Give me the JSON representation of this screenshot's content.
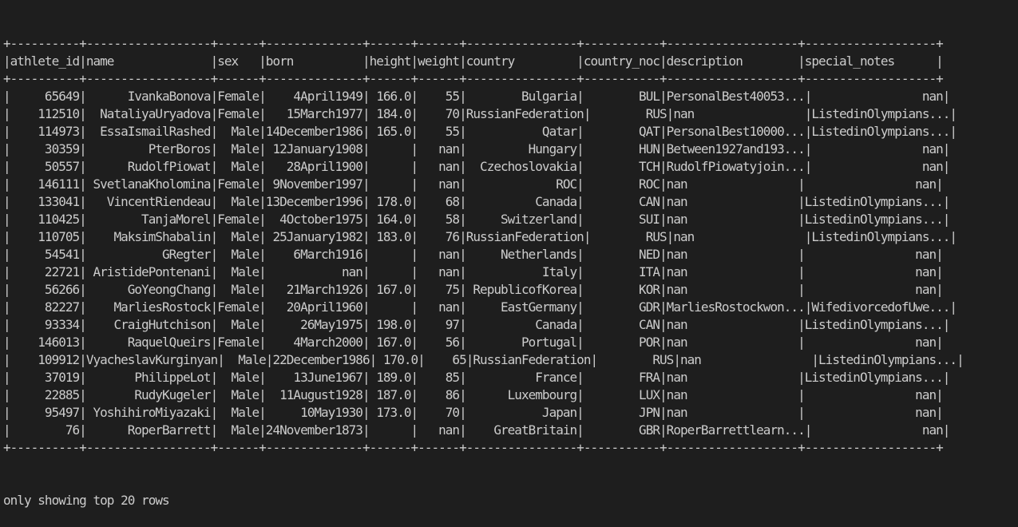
{
  "terminal": {
    "columns": [
      "athlete_id",
      "name",
      "sex",
      "born",
      "height",
      "weight",
      "country",
      "country_noc",
      "description",
      "special_notes"
    ],
    "column_widths": [
      10,
      18,
      6,
      14,
      6,
      6,
      16,
      11,
      19,
      19
    ],
    "align": [
      "right",
      "right",
      "right",
      "right",
      "right",
      "right",
      "right",
      "right",
      "left",
      "right"
    ],
    "rows": [
      [
        "65649",
        "IvankaBonova",
        "Female",
        "4April1949",
        "166.0",
        "55",
        "Bulgaria",
        "BUL",
        "PersonalBest40053...",
        "nan"
      ],
      [
        "112510",
        "NataliyaUryadova",
        "Female",
        "15March1977",
        "184.0",
        "70",
        "RussianFederation",
        "RUS",
        "nan",
        "ListedinOlympians..."
      ],
      [
        "114973",
        "EssaIsmailRashed",
        "Male",
        "14December1986",
        "165.0",
        "55",
        "Qatar",
        "QAT",
        "PersonalBest10000...",
        "ListedinOlympians..."
      ],
      [
        "30359",
        "PterBoros",
        "Male",
        "12January1908",
        "",
        "nan",
        "Hungary",
        "HUN",
        "Between1927and193...",
        "nan"
      ],
      [
        "50557",
        "RudolfPiowat",
        "Male",
        "28April1900",
        "",
        "nan",
        "Czechoslovakia",
        "TCH",
        "RudolfPiowatyjoin...",
        "nan"
      ],
      [
        "146111",
        "SvetlanaKholomina",
        "Female",
        "9November1997",
        "",
        "nan",
        "ROC",
        "ROC",
        "nan",
        "nan"
      ],
      [
        "133041",
        "VincentRiendeau",
        "Male",
        "13December1996",
        "178.0",
        "68",
        "Canada",
        "CAN",
        "nan",
        "ListedinOlympians..."
      ],
      [
        "110425",
        "TanjaMorel",
        "Female",
        "4October1975",
        "164.0",
        "58",
        "Switzerland",
        "SUI",
        "nan",
        "ListedinOlympians..."
      ],
      [
        "110705",
        "MaksimShabalin",
        "Male",
        "25January1982",
        "183.0",
        "76",
        "RussianFederation",
        "RUS",
        "nan",
        "ListedinOlympians..."
      ],
      [
        "54541",
        "GRegter",
        "Male",
        "6March1916",
        "",
        "nan",
        "Netherlands",
        "NED",
        "nan",
        "nan"
      ],
      [
        "22721",
        "AristidePontenani",
        "Male",
        "nan",
        "",
        "nan",
        "Italy",
        "ITA",
        "nan",
        "nan"
      ],
      [
        "56266",
        "GoYeongChang",
        "Male",
        "21March1926",
        "167.0",
        "75",
        "RepublicofKorea",
        "KOR",
        "nan",
        "nan"
      ],
      [
        "82227",
        "MarliesRostock",
        "Female",
        "20April1960",
        "",
        "nan",
        "EastGermany",
        "GDR",
        "MarliesRostockwon...",
        "WifedivorcedofUwe..."
      ],
      [
        "93334",
        "CraigHutchison",
        "Male",
        "26May1975",
        "198.0",
        "97",
        "Canada",
        "CAN",
        "nan",
        "ListedinOlympians..."
      ],
      [
        "146013",
        "RaquelQueirs",
        "Female",
        "4March2000",
        "167.0",
        "56",
        "Portugal",
        "POR",
        "nan",
        "nan"
      ],
      [
        "109912",
        "VyacheslavKurginyan",
        "Male",
        "22December1986",
        "170.0",
        "65",
        "RussianFederation",
        "RUS",
        "nan",
        "ListedinOlympians..."
      ],
      [
        "37019",
        "PhilippeLot",
        "Male",
        "13June1967",
        "189.0",
        "85",
        "France",
        "FRA",
        "nan",
        "ListedinOlympians..."
      ],
      [
        "22885",
        "RudyKugeler",
        "Male",
        "11August1928",
        "187.0",
        "86",
        "Luxembourg",
        "LUX",
        "nan",
        "nan"
      ],
      [
        "95497",
        "YoshihiroMiyazaki",
        "Male",
        "10May1930",
        "173.0",
        "70",
        "Japan",
        "JPN",
        "nan",
        "nan"
      ],
      [
        "76",
        "RoperBarrett",
        "Male",
        "24November1873",
        "",
        "nan",
        "GreatBritain",
        "GBR",
        "RoperBarrettlearn...",
        "nan"
      ]
    ],
    "footer": "only showing top 20 rows"
  }
}
